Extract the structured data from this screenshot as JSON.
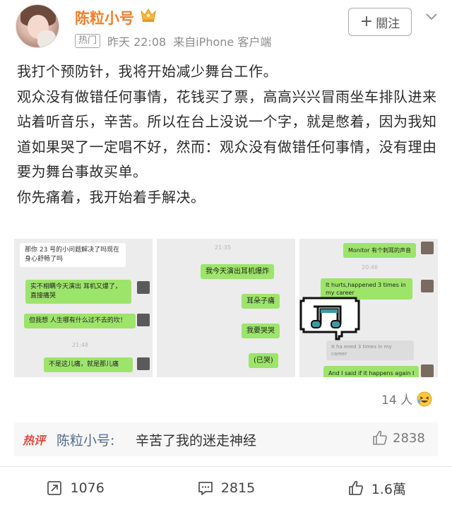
{
  "post": {
    "author": "陈粒小号",
    "hot_badge": "热门",
    "time": "昨天 22:08",
    "source": "来自iPhone 客户端",
    "follow_label": "關注",
    "paragraphs": [
      "我打个预防针，我将开始减少舞台工作。",
      "观众没有做错任何事情，花钱买了票，高高兴兴冒雨坐车排队进来站着听音乐，辛苦。所以在台上没说一个字，就是憋着，因为我知道如果哭了一定唱不好，然而：观众没有做错任何事情，没有理由要为舞台事故买单。",
      "你先痛着，我开始着手解决。"
    ]
  },
  "images": {
    "shot1": {
      "msg1": "那你 23 号的小问题解决了吗现在身心舒畅了吗",
      "msg2": "实不相瞒今天演出 耳机又爆了，直接痛哭",
      "msg3": "但我想 人生哪有什么过不去的坎！",
      "time": "21:48",
      "msg4": "不是这儿痛，就是那儿痛"
    },
    "shot2": {
      "time": "21:35",
      "msg1": "我今天演出耳机爆炸",
      "msg2": "耳朵子痛",
      "msg3": "我要哭哭",
      "msg4": "(已哭)"
    },
    "shot3": {
      "msg1": "Monitor 有个刺耳的声音",
      "time": "20:46",
      "msg2": "It hurts,happened 3 times in my career",
      "msg3": "It ha                ened 3 times in my career",
      "msg4": "And I said if it happens again I"
    }
  },
  "reactions": {
    "count": "14 人"
  },
  "hot_comment": {
    "tag": "热评",
    "user": "陈粒小号:",
    "text": "辛苦了我的迷走神经",
    "likes": "2838"
  },
  "actions": {
    "repost": "1076",
    "comment": "2815",
    "like": "1.6萬"
  },
  "colors": {
    "username": "#f07f2b",
    "hot_tag": "#e5483c",
    "link_user": "#526b8c",
    "chat_green": "#9de46a"
  }
}
